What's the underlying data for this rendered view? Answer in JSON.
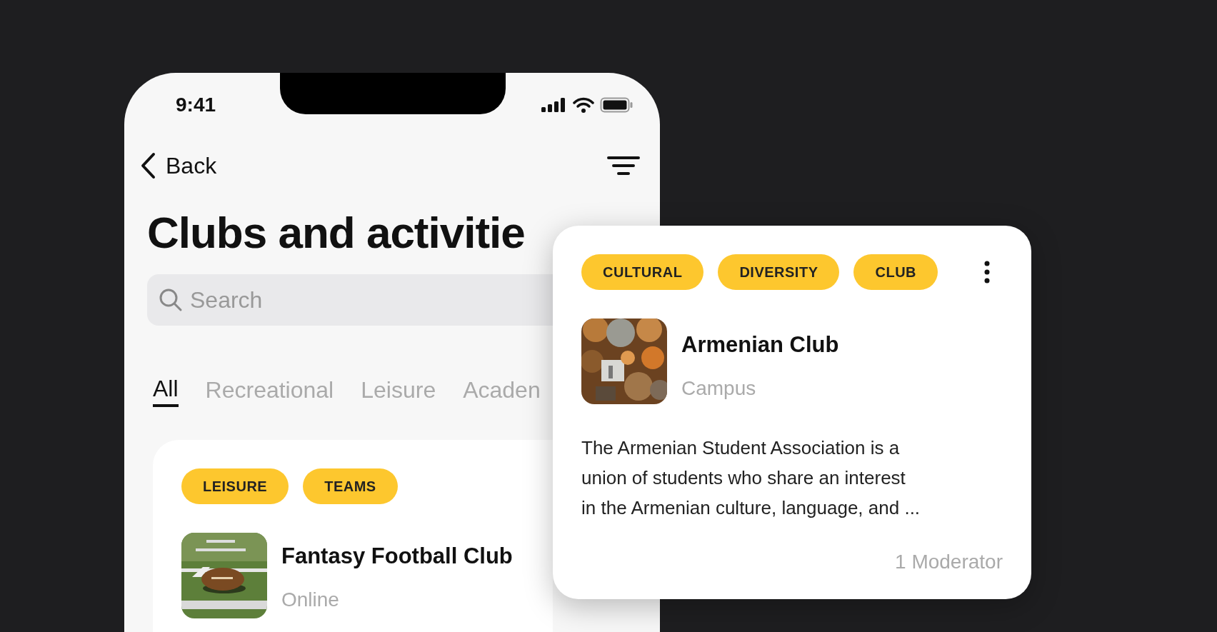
{
  "status_bar": {
    "time": "9:41"
  },
  "nav": {
    "back_label": "Back"
  },
  "title": "Clubs and activitie",
  "search": {
    "placeholder": "Search"
  },
  "tabs": [
    {
      "label": "All",
      "selected": true
    },
    {
      "label": "Recreational",
      "selected": false
    },
    {
      "label": "Leisure",
      "selected": false
    },
    {
      "label": "Acaden",
      "selected": false
    }
  ],
  "club_cards": [
    {
      "tags": [
        "LEISURE",
        "TEAMS"
      ],
      "name": "Fantasy Football Club",
      "location": "Online"
    }
  ],
  "detail_card": {
    "tags": [
      "CULTURAL",
      "DIVERSITY",
      "CLUB"
    ],
    "name": "Armenian Club",
    "location": "Campus",
    "description": "The Armenian Student Association is a union of students who share an interest in the Armenian culture, language, and ...",
    "moderators": "1 Moderator"
  }
}
